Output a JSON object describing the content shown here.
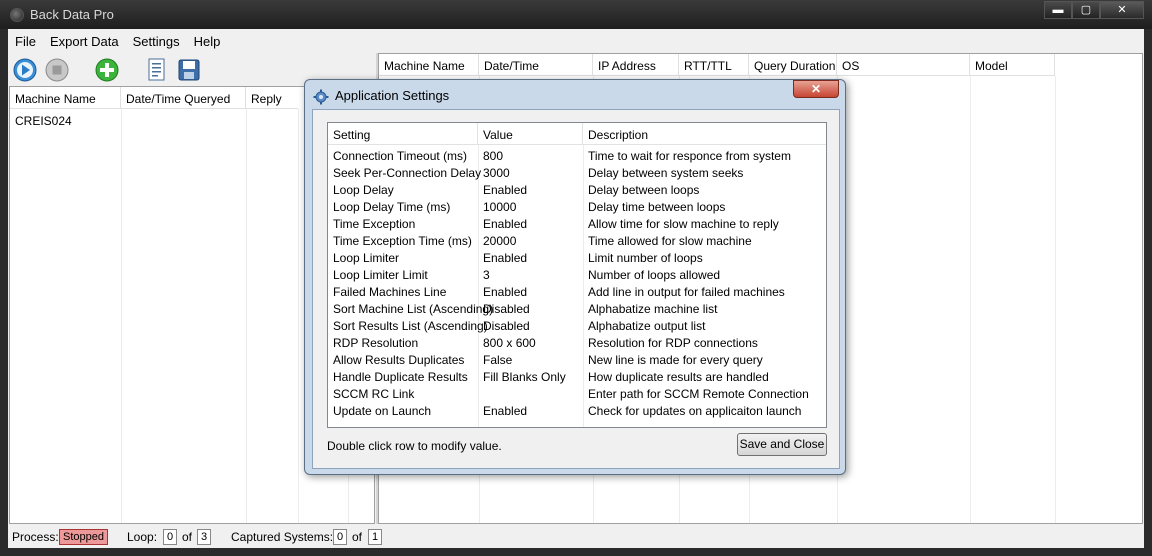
{
  "window": {
    "title": "Back Data Pro",
    "minimize": "▬",
    "maximize": "▢",
    "close": "✕"
  },
  "menu": [
    "File",
    "Export Data",
    "Settings",
    "Help"
  ],
  "left_table": {
    "columns": [
      "Machine Name",
      "Date/Time Queryed",
      "Reply"
    ],
    "rows": [
      [
        "CREIS024",
        "",
        ""
      ]
    ]
  },
  "right_table": {
    "columns": [
      "Machine Name",
      "Date/Time",
      "IP Address",
      "RTT/TTL",
      "Query Duration",
      "OS",
      "Model"
    ]
  },
  "status": {
    "process_label": "Process:",
    "process_value": "Stopped",
    "loop_label": "Loop:",
    "loop_current": "0",
    "of1": "of",
    "loop_total": "3",
    "captured_label": "Captured Systems:",
    "captured_current": "0",
    "of2": "of",
    "captured_total": "1"
  },
  "dialog": {
    "title": "Application Settings",
    "close": "✕",
    "columns": [
      "Setting",
      "Value",
      "Description"
    ],
    "rows": [
      [
        "Connection Timeout (ms)",
        "800",
        "Time to wait for responce from system"
      ],
      [
        "Seek Per-Connection Delay",
        "3000",
        "Delay between system seeks"
      ],
      [
        "Loop Delay",
        "Enabled",
        "Delay between loops"
      ],
      [
        "Loop Delay Time (ms)",
        "10000",
        "Delay time between loops"
      ],
      [
        "Time Exception",
        "Enabled",
        "Allow time for slow machine to reply"
      ],
      [
        "Time Exception Time (ms)",
        "20000",
        "Time allowed for slow machine"
      ],
      [
        "Loop Limiter",
        "Enabled",
        "Limit number of loops"
      ],
      [
        "Loop Limiter Limit",
        "3",
        "Number of loops allowed"
      ],
      [
        "Failed Machines Line",
        "Enabled",
        "Add line in output for failed machines"
      ],
      [
        "Sort Machine List (Ascending)",
        "Disabled",
        "Alphabatize machine list"
      ],
      [
        "Sort Results List (Ascending)",
        "Disabled",
        "Alphabatize output list"
      ],
      [
        "RDP Resolution",
        "800 x 600",
        "Resolution for RDP connections"
      ],
      [
        "Allow Results Duplicates",
        "False",
        "New line is made for every query"
      ],
      [
        "Handle Duplicate Results",
        "Fill Blanks Only",
        "How duplicate results are handled"
      ],
      [
        "SCCM RC Link",
        "",
        "Enter path for SCCM Remote Connection"
      ],
      [
        "Update on Launch",
        "Enabled",
        "Check for updates on applicaiton launch"
      ]
    ],
    "hint": "Double click row to modify value.",
    "save_button": "Save and Close"
  },
  "icons": [
    "play-icon",
    "stop-icon",
    "add-icon",
    "document-icon",
    "save-icon",
    "gear-icon"
  ]
}
